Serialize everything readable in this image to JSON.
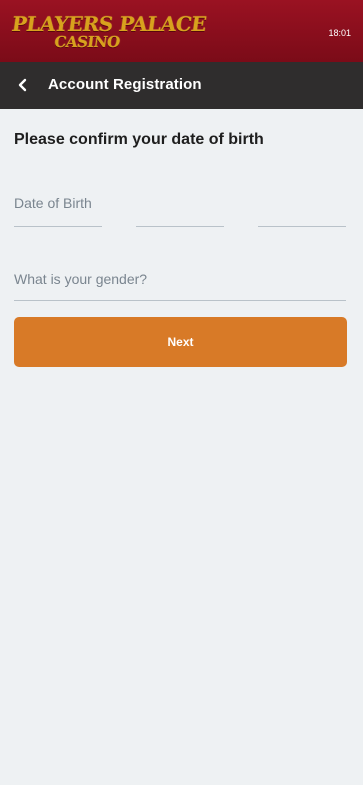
{
  "brand": {
    "logo_line1": "PLAYERS PALACE",
    "logo_line2": "CASINO",
    "time": "18:01"
  },
  "header": {
    "title": "Account Registration",
    "back_icon": "chevron-left-icon"
  },
  "form": {
    "heading": "Please confirm your date of birth",
    "dob_label": "Date of Birth",
    "gender_label": "What is your gender?",
    "next_label": "Next"
  },
  "colors": {
    "brand_red": "#8f1020",
    "logo_gold": "#d8a21d",
    "header_dark": "#2f2d2d",
    "page_bg": "#eef1f3",
    "button_orange": "#d87a27",
    "input_line": "#b9c2c9",
    "placeholder_text": "#7a858f"
  }
}
